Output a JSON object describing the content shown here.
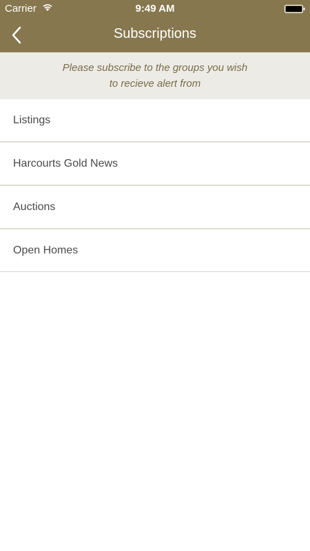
{
  "status_bar": {
    "carrier": "Carrier",
    "time": "9:49 AM",
    "wifi_icon": "wifi-icon",
    "battery_icon": "battery-icon"
  },
  "nav": {
    "title": "Subscriptions",
    "back_icon": "chevron-left-icon"
  },
  "banner": {
    "line1": "Please subscribe to the groups you wish",
    "line2": "to recieve alert from"
  },
  "subscriptions": [
    {
      "label": "Listings"
    },
    {
      "label": "Harcourts Gold News"
    },
    {
      "label": "Auctions"
    },
    {
      "label": "Open Homes"
    }
  ],
  "colors": {
    "header_bg": "#86774e",
    "banner_bg": "#ecebe6",
    "banner_text": "#7b6c48",
    "divider": "#dfdcd0"
  }
}
